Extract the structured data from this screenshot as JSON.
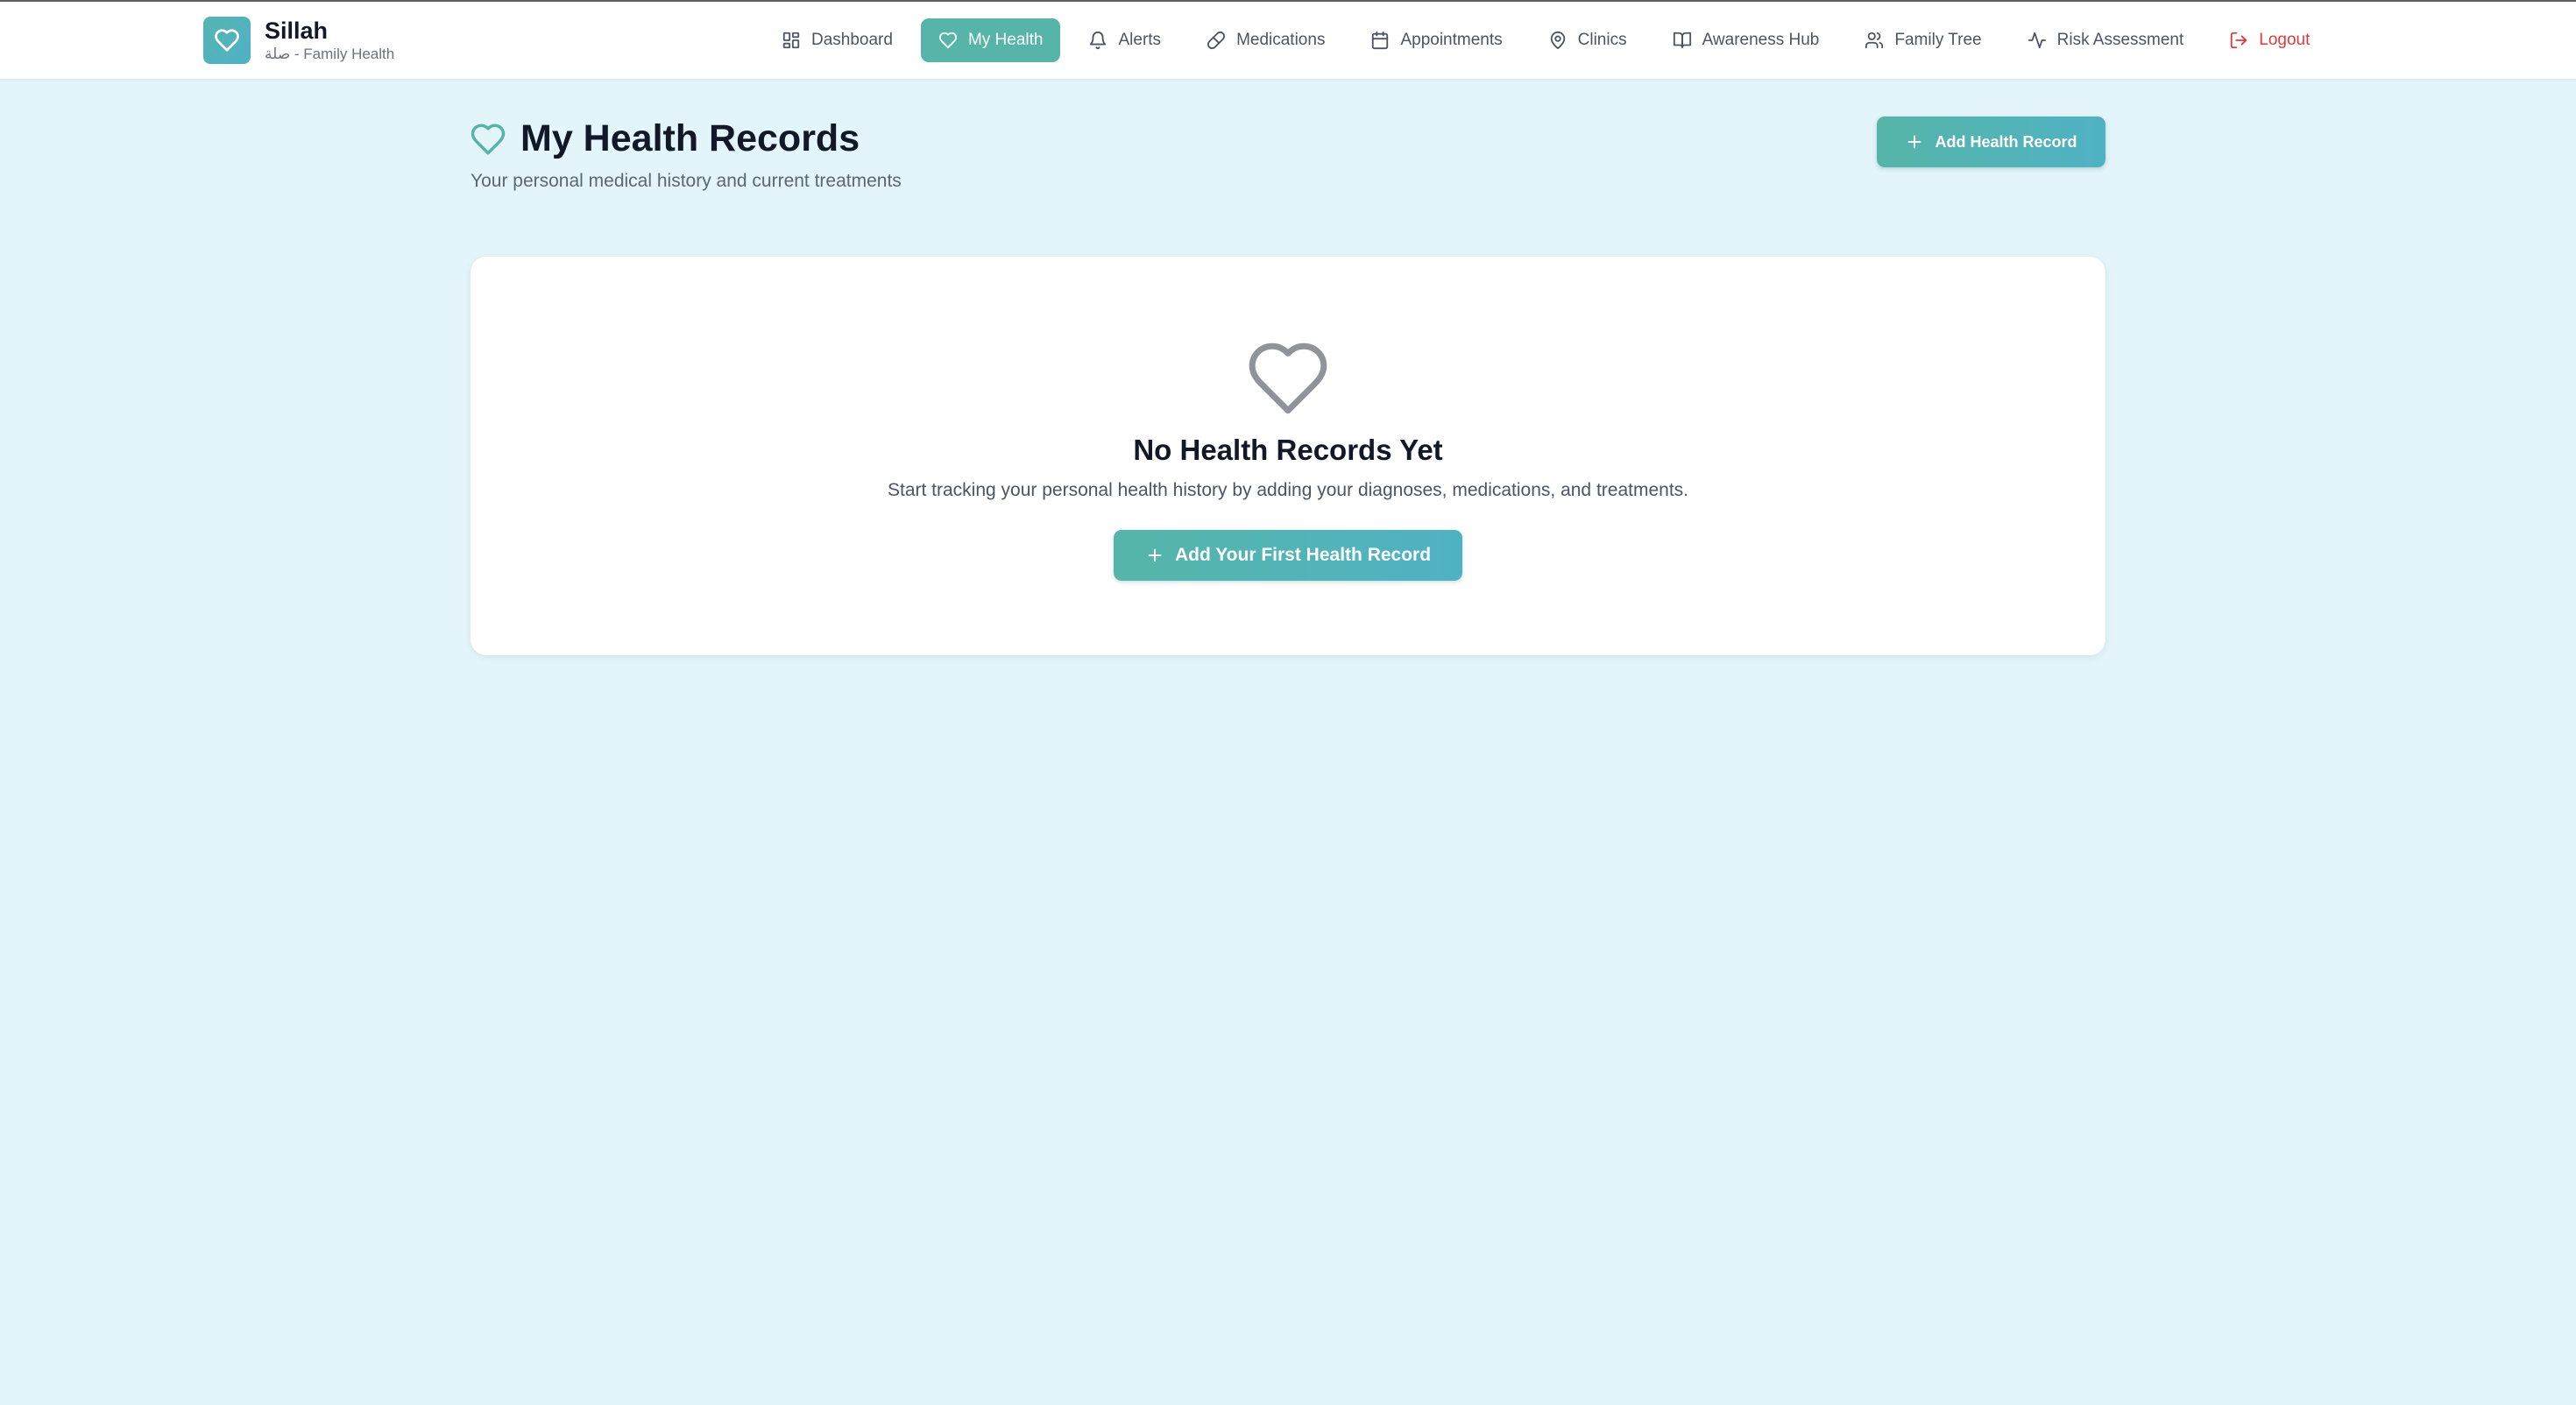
{
  "brand": {
    "name": "Sillah",
    "subtitle": "صلة - Family Health"
  },
  "nav": {
    "items": [
      {
        "label": "Dashboard",
        "icon": "dashboard-icon"
      },
      {
        "label": "My Health",
        "icon": "heart-icon",
        "active": true
      },
      {
        "label": "Alerts",
        "icon": "bell-icon"
      },
      {
        "label": "Medications",
        "icon": "pill-icon"
      },
      {
        "label": "Appointments",
        "icon": "calendar-icon"
      },
      {
        "label": "Clinics",
        "icon": "map-pin-icon"
      },
      {
        "label": "Awareness Hub",
        "icon": "book-icon"
      },
      {
        "label": "Family Tree",
        "icon": "users-icon"
      },
      {
        "label": "Risk Assessment",
        "icon": "activity-icon"
      }
    ],
    "logout_label": "Logout"
  },
  "page": {
    "title": "My Health Records",
    "subtitle": "Your personal medical history and current treatments",
    "add_button_label": "Add Health Record"
  },
  "empty_state": {
    "title": "No Health Records Yet",
    "description": "Start tracking your personal health history by adding your diagnoses, medications, and treatments.",
    "button_label": "Add Your First Health Record"
  },
  "colors": {
    "accent": "#56b5a8",
    "accent_secondary": "#4fb2c4",
    "background": "#e3f4fa",
    "logout": "#dc3b3b",
    "heading": "#111827",
    "muted_text": "#5d6673"
  }
}
